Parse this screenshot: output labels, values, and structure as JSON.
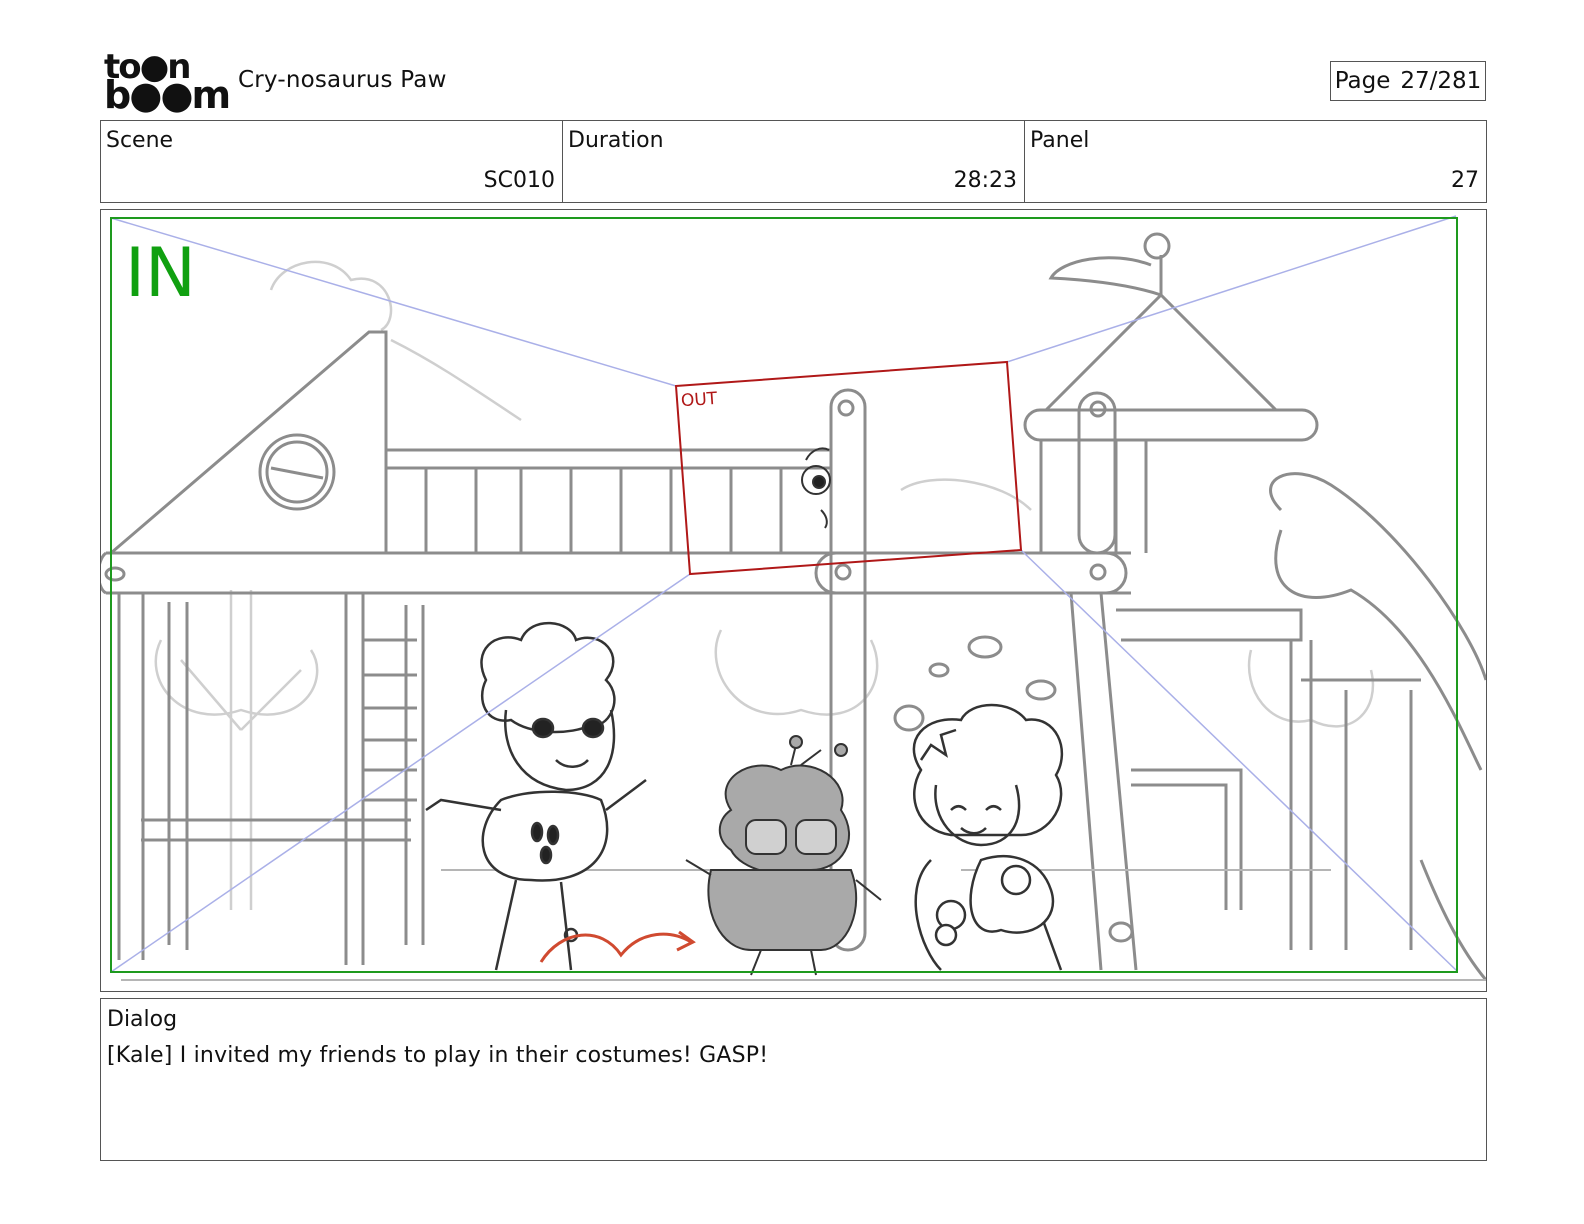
{
  "header": {
    "logo_line1": "to●n",
    "logo_line2": "b●●m",
    "project_title": "Cry-nosaurus Paw",
    "page_label": "Page",
    "page_value": "27/281"
  },
  "info": {
    "scene_label": "Scene",
    "scene_value": "SC010",
    "duration_label": "Duration",
    "duration_value": "28:23",
    "panel_label": "Panel",
    "panel_value": "27"
  },
  "panel": {
    "in_label": "IN",
    "out_label": "OUT",
    "colors": {
      "in_frame": "#1e9a1e",
      "out_frame": "#b01818",
      "guide": "#aab0e8",
      "sketch": "#8c8c8c",
      "arrow": "#d04a30"
    }
  },
  "dialog": {
    "label": "Dialog",
    "text": "[Kale] I invited my friends to play in their costumes! GASP!"
  }
}
